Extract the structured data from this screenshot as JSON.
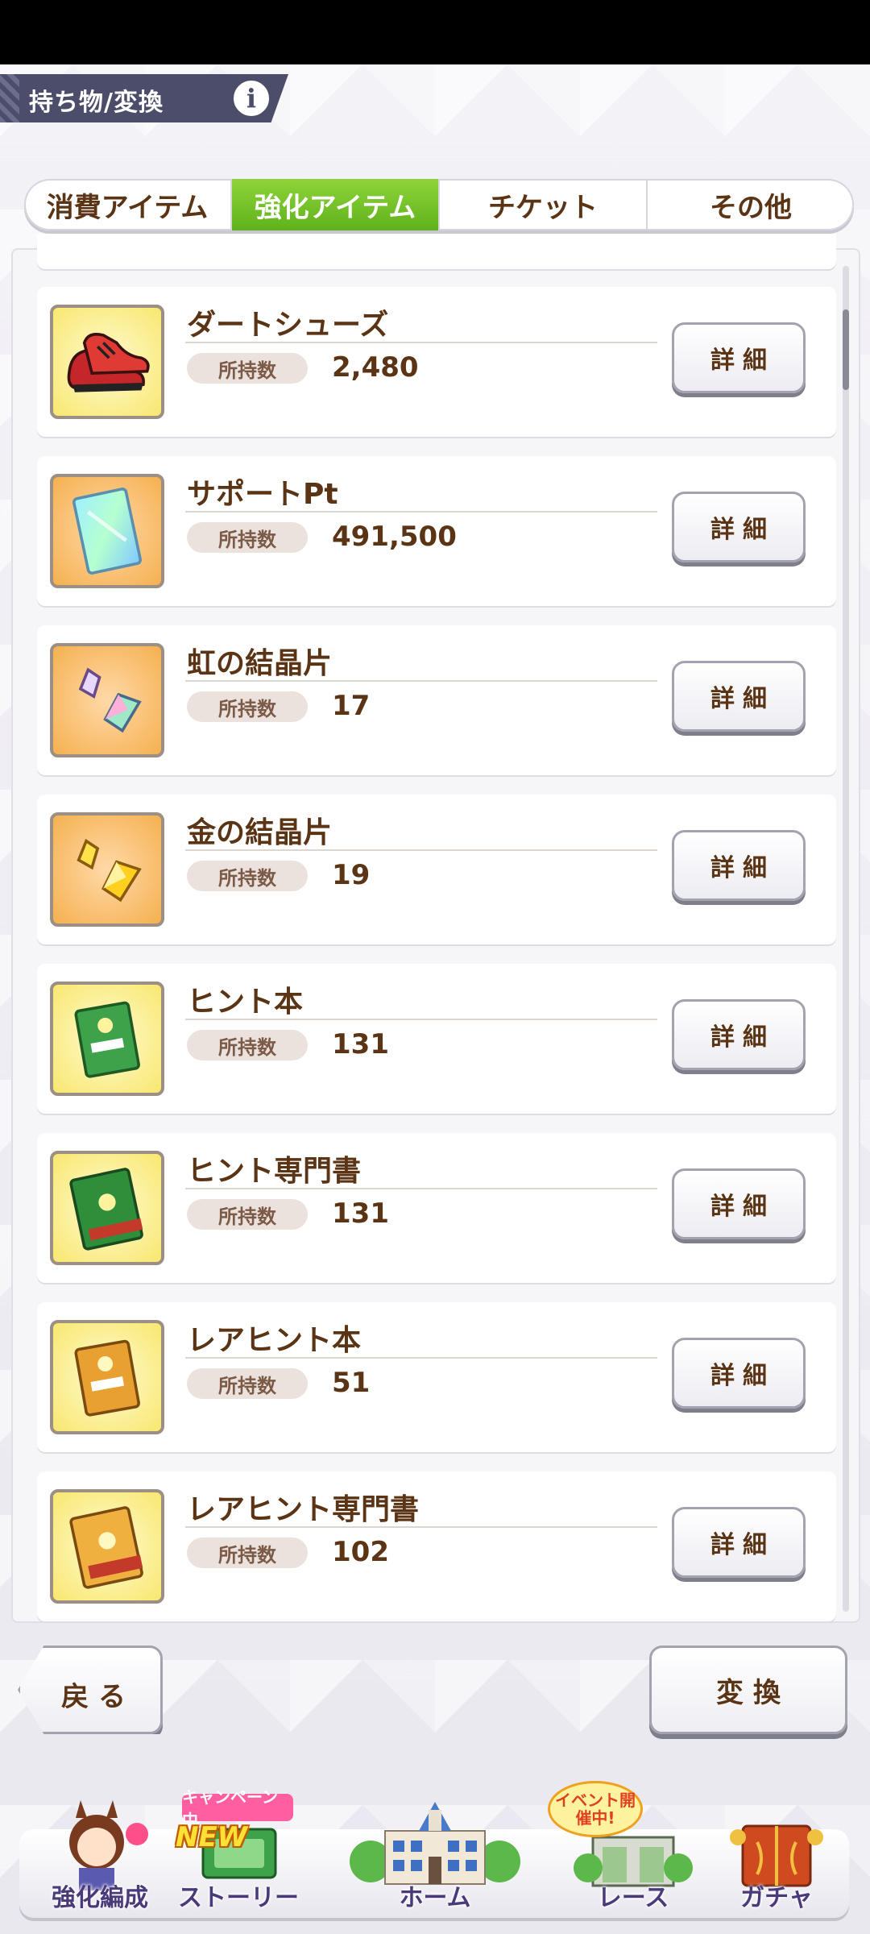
{
  "header": {
    "title": "持ち物/変換",
    "info_icon": "i"
  },
  "tabs": [
    {
      "label": "消費アイテム",
      "active": false
    },
    {
      "label": "強化アイテム",
      "active": true
    },
    {
      "label": "チケット",
      "active": false
    },
    {
      "label": "その他",
      "active": false
    }
  ],
  "qty_label": "所持数",
  "detail_label": "詳細",
  "items": [
    {
      "name": "ダートシューズ",
      "qty": "2,480",
      "icon": "dirt-shoes-icon"
    },
    {
      "name": "サポートPt",
      "qty": "491,500",
      "icon": "support-pt-card-icon"
    },
    {
      "name": "虹の結晶片",
      "qty": "17",
      "icon": "rainbow-crystal-icon"
    },
    {
      "name": "金の結晶片",
      "qty": "19",
      "icon": "gold-crystal-icon"
    },
    {
      "name": "ヒント本",
      "qty": "131",
      "icon": "hint-book-icon"
    },
    {
      "name": "ヒント専門書",
      "qty": "131",
      "icon": "hint-specialist-book-icon"
    },
    {
      "name": "レアヒント本",
      "qty": "51",
      "icon": "rare-hint-book-icon"
    },
    {
      "name": "レアヒント専門書",
      "qty": "102",
      "icon": "rare-hint-specialist-book-icon"
    }
  ],
  "buttons": {
    "back": "戻る",
    "convert": "変換"
  },
  "nav": {
    "items": [
      {
        "label": "強化編成",
        "icon": "character-icon"
      },
      {
        "label": "ストーリー",
        "icon": "story-book-icon"
      },
      {
        "label": "ホーム",
        "icon": "school-building-icon"
      },
      {
        "label": "レース",
        "icon": "race-gate-icon"
      },
      {
        "label": "ガチャ",
        "icon": "gacha-door-icon"
      }
    ],
    "campaign_badge": "キャンペーン中",
    "new_badge": "NEW",
    "event_badge": "イベント開催中!"
  },
  "colors": {
    "accent_green": "#6cc02a",
    "text_brown": "#5a3414",
    "header_plate": "#4c4d6b"
  }
}
